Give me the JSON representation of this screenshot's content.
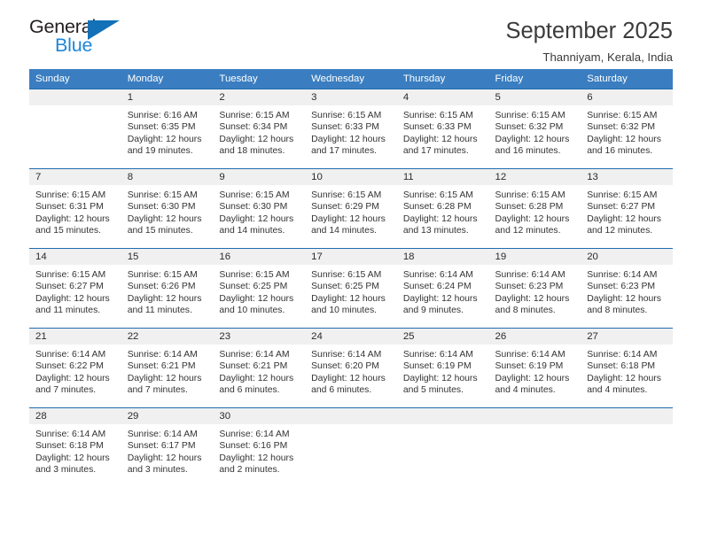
{
  "brand": {
    "name_dark": "General",
    "name_blue": "Blue",
    "accent_blue": "#1f87d8",
    "triangle_blue": "#1271b7"
  },
  "header": {
    "title": "September 2025",
    "subtitle": "Thanniyam, Kerala, India"
  },
  "colors": {
    "header_bar": "#3a7ec1",
    "row_divider": "#1f6cb0",
    "daynum_band": "#f0f0f0"
  },
  "weekdays": [
    "Sunday",
    "Monday",
    "Tuesday",
    "Wednesday",
    "Thursday",
    "Friday",
    "Saturday"
  ],
  "weeks": [
    [
      {
        "day": "",
        "sunrise": "",
        "sunset": "",
        "daylight1": "",
        "daylight2": ""
      },
      {
        "day": "1",
        "sunrise": "Sunrise: 6:16 AM",
        "sunset": "Sunset: 6:35 PM",
        "daylight1": "Daylight: 12 hours",
        "daylight2": "and 19 minutes."
      },
      {
        "day": "2",
        "sunrise": "Sunrise: 6:15 AM",
        "sunset": "Sunset: 6:34 PM",
        "daylight1": "Daylight: 12 hours",
        "daylight2": "and 18 minutes."
      },
      {
        "day": "3",
        "sunrise": "Sunrise: 6:15 AM",
        "sunset": "Sunset: 6:33 PM",
        "daylight1": "Daylight: 12 hours",
        "daylight2": "and 17 minutes."
      },
      {
        "day": "4",
        "sunrise": "Sunrise: 6:15 AM",
        "sunset": "Sunset: 6:33 PM",
        "daylight1": "Daylight: 12 hours",
        "daylight2": "and 17 minutes."
      },
      {
        "day": "5",
        "sunrise": "Sunrise: 6:15 AM",
        "sunset": "Sunset: 6:32 PM",
        "daylight1": "Daylight: 12 hours",
        "daylight2": "and 16 minutes."
      },
      {
        "day": "6",
        "sunrise": "Sunrise: 6:15 AM",
        "sunset": "Sunset: 6:32 PM",
        "daylight1": "Daylight: 12 hours",
        "daylight2": "and 16 minutes."
      }
    ],
    [
      {
        "day": "7",
        "sunrise": "Sunrise: 6:15 AM",
        "sunset": "Sunset: 6:31 PM",
        "daylight1": "Daylight: 12 hours",
        "daylight2": "and 15 minutes."
      },
      {
        "day": "8",
        "sunrise": "Sunrise: 6:15 AM",
        "sunset": "Sunset: 6:30 PM",
        "daylight1": "Daylight: 12 hours",
        "daylight2": "and 15 minutes."
      },
      {
        "day": "9",
        "sunrise": "Sunrise: 6:15 AM",
        "sunset": "Sunset: 6:30 PM",
        "daylight1": "Daylight: 12 hours",
        "daylight2": "and 14 minutes."
      },
      {
        "day": "10",
        "sunrise": "Sunrise: 6:15 AM",
        "sunset": "Sunset: 6:29 PM",
        "daylight1": "Daylight: 12 hours",
        "daylight2": "and 14 minutes."
      },
      {
        "day": "11",
        "sunrise": "Sunrise: 6:15 AM",
        "sunset": "Sunset: 6:28 PM",
        "daylight1": "Daylight: 12 hours",
        "daylight2": "and 13 minutes."
      },
      {
        "day": "12",
        "sunrise": "Sunrise: 6:15 AM",
        "sunset": "Sunset: 6:28 PM",
        "daylight1": "Daylight: 12 hours",
        "daylight2": "and 12 minutes."
      },
      {
        "day": "13",
        "sunrise": "Sunrise: 6:15 AM",
        "sunset": "Sunset: 6:27 PM",
        "daylight1": "Daylight: 12 hours",
        "daylight2": "and 12 minutes."
      }
    ],
    [
      {
        "day": "14",
        "sunrise": "Sunrise: 6:15 AM",
        "sunset": "Sunset: 6:27 PM",
        "daylight1": "Daylight: 12 hours",
        "daylight2": "and 11 minutes."
      },
      {
        "day": "15",
        "sunrise": "Sunrise: 6:15 AM",
        "sunset": "Sunset: 6:26 PM",
        "daylight1": "Daylight: 12 hours",
        "daylight2": "and 11 minutes."
      },
      {
        "day": "16",
        "sunrise": "Sunrise: 6:15 AM",
        "sunset": "Sunset: 6:25 PM",
        "daylight1": "Daylight: 12 hours",
        "daylight2": "and 10 minutes."
      },
      {
        "day": "17",
        "sunrise": "Sunrise: 6:15 AM",
        "sunset": "Sunset: 6:25 PM",
        "daylight1": "Daylight: 12 hours",
        "daylight2": "and 10 minutes."
      },
      {
        "day": "18",
        "sunrise": "Sunrise: 6:14 AM",
        "sunset": "Sunset: 6:24 PM",
        "daylight1": "Daylight: 12 hours",
        "daylight2": "and 9 minutes."
      },
      {
        "day": "19",
        "sunrise": "Sunrise: 6:14 AM",
        "sunset": "Sunset: 6:23 PM",
        "daylight1": "Daylight: 12 hours",
        "daylight2": "and 8 minutes."
      },
      {
        "day": "20",
        "sunrise": "Sunrise: 6:14 AM",
        "sunset": "Sunset: 6:23 PM",
        "daylight1": "Daylight: 12 hours",
        "daylight2": "and 8 minutes."
      }
    ],
    [
      {
        "day": "21",
        "sunrise": "Sunrise: 6:14 AM",
        "sunset": "Sunset: 6:22 PM",
        "daylight1": "Daylight: 12 hours",
        "daylight2": "and 7 minutes."
      },
      {
        "day": "22",
        "sunrise": "Sunrise: 6:14 AM",
        "sunset": "Sunset: 6:21 PM",
        "daylight1": "Daylight: 12 hours",
        "daylight2": "and 7 minutes."
      },
      {
        "day": "23",
        "sunrise": "Sunrise: 6:14 AM",
        "sunset": "Sunset: 6:21 PM",
        "daylight1": "Daylight: 12 hours",
        "daylight2": "and 6 minutes."
      },
      {
        "day": "24",
        "sunrise": "Sunrise: 6:14 AM",
        "sunset": "Sunset: 6:20 PM",
        "daylight1": "Daylight: 12 hours",
        "daylight2": "and 6 minutes."
      },
      {
        "day": "25",
        "sunrise": "Sunrise: 6:14 AM",
        "sunset": "Sunset: 6:19 PM",
        "daylight1": "Daylight: 12 hours",
        "daylight2": "and 5 minutes."
      },
      {
        "day": "26",
        "sunrise": "Sunrise: 6:14 AM",
        "sunset": "Sunset: 6:19 PM",
        "daylight1": "Daylight: 12 hours",
        "daylight2": "and 4 minutes."
      },
      {
        "day": "27",
        "sunrise": "Sunrise: 6:14 AM",
        "sunset": "Sunset: 6:18 PM",
        "daylight1": "Daylight: 12 hours",
        "daylight2": "and 4 minutes."
      }
    ],
    [
      {
        "day": "28",
        "sunrise": "Sunrise: 6:14 AM",
        "sunset": "Sunset: 6:18 PM",
        "daylight1": "Daylight: 12 hours",
        "daylight2": "and 3 minutes."
      },
      {
        "day": "29",
        "sunrise": "Sunrise: 6:14 AM",
        "sunset": "Sunset: 6:17 PM",
        "daylight1": "Daylight: 12 hours",
        "daylight2": "and 3 minutes."
      },
      {
        "day": "30",
        "sunrise": "Sunrise: 6:14 AM",
        "sunset": "Sunset: 6:16 PM",
        "daylight1": "Daylight: 12 hours",
        "daylight2": "and 2 minutes."
      },
      {
        "day": "",
        "sunrise": "",
        "sunset": "",
        "daylight1": "",
        "daylight2": ""
      },
      {
        "day": "",
        "sunrise": "",
        "sunset": "",
        "daylight1": "",
        "daylight2": ""
      },
      {
        "day": "",
        "sunrise": "",
        "sunset": "",
        "daylight1": "",
        "daylight2": ""
      },
      {
        "day": "",
        "sunrise": "",
        "sunset": "",
        "daylight1": "",
        "daylight2": ""
      }
    ]
  ]
}
